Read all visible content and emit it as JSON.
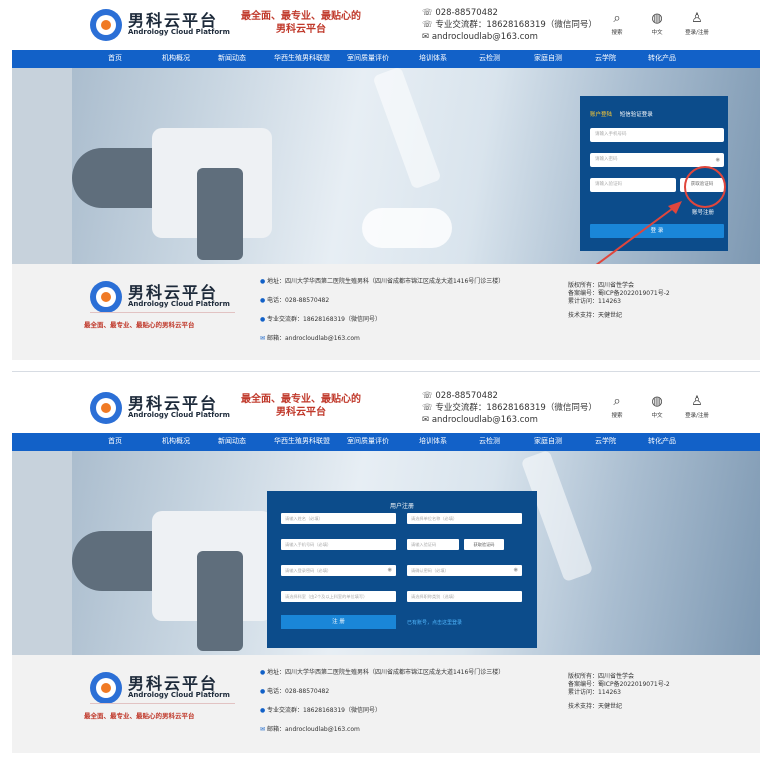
{
  "header": {
    "logo_cn": "男科云平台",
    "logo_en": "Andrology Cloud Platform",
    "slogan_line1": "最全面、最专业、最贴心的",
    "slogan_line2": "男科云平台",
    "phone": "028-88570482",
    "group": "专业交流群：18628168319（微信同号）",
    "email": "androcloudlab@163.com",
    "tools": [
      {
        "icon": "search-icon",
        "label": "搜索"
      },
      {
        "icon": "globe-icon",
        "label": "中文"
      },
      {
        "icon": "user-icon",
        "label": "登录/注册"
      }
    ]
  },
  "nav": {
    "items": [
      "首页",
      "机构概况",
      "新闻动态",
      "华西生殖男科联盟",
      "室间质量评价",
      "培训体系",
      "云检测",
      "家庭自测",
      "云学院",
      "转化产品"
    ]
  },
  "login_panel": {
    "tab_account": "账户登陆",
    "tab_sms": "短信验证登录",
    "phone_placeholder": "请输入手机号码",
    "password_placeholder": "请输入密码",
    "code_placeholder": "请输入验证码",
    "get_code": "获取验证码",
    "register_link": "账号注册",
    "submit": "登 录"
  },
  "register_panel": {
    "title": "用户注册",
    "fields": [
      "请输入姓名（必填）",
      "请选择单位名称（必填）",
      "请输入手机号码（必填）",
      "请输入验证码",
      "请输入登录密码（必填）",
      "请确认密码（必填）",
      "请选择科室（由2个及以上科室的单位填写）",
      "请选择职称类别（选填）"
    ],
    "get_code": "获取验证码",
    "submit": "注 册",
    "login_link": "已有账号，点击这里登录"
  },
  "footer": {
    "slogan": "最全面、最专业、最贴心的男科云平台",
    "address": "地址：四川大学华西第二医院生殖男科（四川省成都市锦江区成龙大道1416号门诊三楼）",
    "phone": "电话：028-88570482",
    "group": "专业交流群：18628168319（微信同号）",
    "email": "邮箱：androcloudlab@163.com",
    "copyright": "版权所有：四川省性学会",
    "icp": "备案编号：蜀ICP备2022019071号-2",
    "visits": "累计访问：114263",
    "support": "技术支持：天健世纪"
  },
  "colors": {
    "nav_blue": "#1261c8",
    "panel_blue": "#0c4c8b",
    "button_blue": "#1a86d8",
    "slogan_red": "#c0392b",
    "highlight_red": "#e0463c"
  }
}
